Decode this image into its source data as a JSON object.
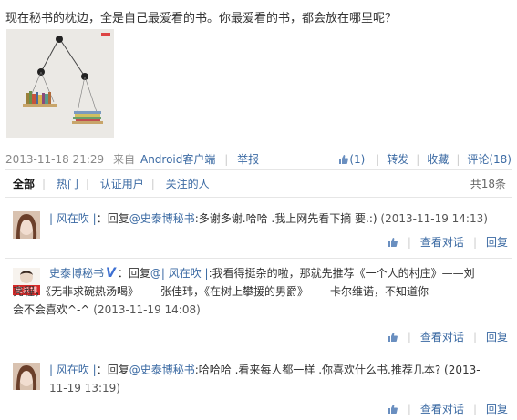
{
  "post": {
    "text": "现在秘书的枕边，全是自己最爱看的书。你最爱看的书，都会放在哪里呢？",
    "time": "2013-11-18 21:29",
    "source_prefix": "来自",
    "source_link": "Android客户端",
    "report": "举报",
    "like_count": "(1)",
    "repost": "转发",
    "favorite": "收藏",
    "comment_label": "评论(18)"
  },
  "tabs": {
    "all": "全部",
    "hot": "热门",
    "verified": "认证用户",
    "following": "关注的人",
    "total": "共18条"
  },
  "comments": [
    {
      "name": "| 风在吹 |",
      "reply_prefix": "：回复",
      "mention": "@史泰博秘书",
      "text": ":多谢多谢.哈哈 .我上网先看下摘 要.:)",
      "time": "(2013-11-19 14:13)",
      "view_conversation": "查看对话",
      "reply": "回复"
    },
    {
      "name": "史泰博秘书",
      "avatar_text": "史泰博",
      "reply_prefix": "：回复",
      "mention": "@| 风在吹 |",
      "text_line1": ":我看得挺杂的啦，那就先推荐《一个人的村庄》——刘",
      "text_line2": "亮程，《无非求碗热汤喝》——张佳玮，《在树上攀援的男爵》——卡尔维诺，不知道你",
      "text_line3": "会不会喜欢^-^",
      "time": "(2013-11-19 14:08)",
      "view_conversation": "查看对话",
      "reply": "回复"
    },
    {
      "name": "| 风在吹 |",
      "reply_prefix": "：回复",
      "mention": "@史泰博秘书",
      "text_line1": ":哈哈哈 .看来每人都一样 .你喜欢什么书.推荐几本? (2013-",
      "text_line2": "11-19 13:19)",
      "view_conversation": "查看对话",
      "reply": "回复"
    }
  ],
  "colors": {
    "link": "#3b6aa3",
    "meta": "#888888",
    "verified": "#3c6fd2"
  }
}
